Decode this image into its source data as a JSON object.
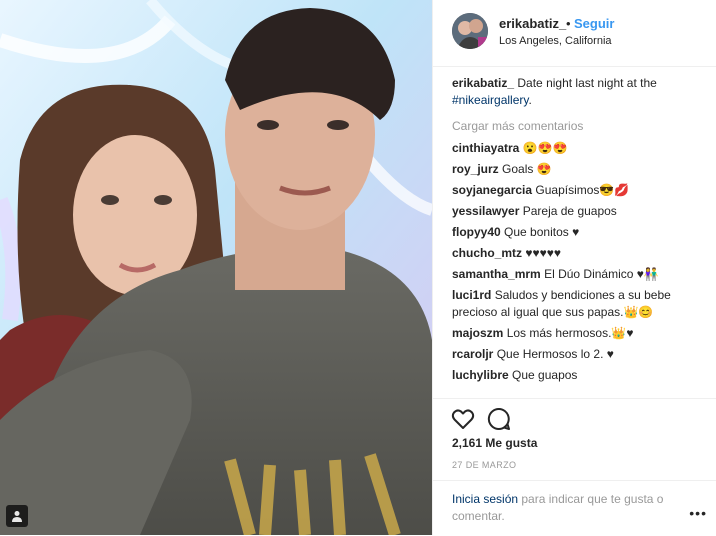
{
  "post": {
    "username": "erikabatiz_",
    "separator": "•",
    "follow_label": "Seguir",
    "location": "Los Angeles, California",
    "caption_user": "erikabatiz_",
    "caption_text": " Date night last night at the ",
    "caption_tag": "#nikeairgallery",
    "caption_end": ".",
    "load_more": "Cargar más comentarios",
    "likes": "2,161 Me gusta",
    "date": "27 DE MARZO",
    "login_link": "Inicia sesión",
    "login_text": " para indicar que te gusta o comentar.",
    "more_icon": "more-options-icon",
    "like_icon": "heart-icon",
    "comment_icon": "comment-bubble-icon"
  },
  "comments": [
    {
      "user": "cinthiayatra",
      "text": "😮😍😍"
    },
    {
      "user": "roy_jurz",
      "text": "Goals 😍"
    },
    {
      "user": "soyjanegarcia",
      "text": "Guapísimos😎💋"
    },
    {
      "user": "yessilawyer",
      "text": "Pareja de guapos"
    },
    {
      "user": "flopyy40",
      "text": "Que bonitos ♥"
    },
    {
      "user": "chucho_mtz",
      "text": "♥♥♥♥♥"
    },
    {
      "user": "samantha_mrm",
      "text": "El Dúo Dinámico ♥👫"
    },
    {
      "user": "luci1rd",
      "text": "Saludos y bendiciones a su bebe precioso al igual que sus papas.👑😊"
    },
    {
      "user": "majoszm",
      "text": "Los más hermosos.👑♥"
    },
    {
      "user": "rcaroljr",
      "text": "Que Hermosos lo 2. ♥"
    },
    {
      "user": "luchylibre",
      "text": "Que guapos"
    },
    {
      "user": "",
      "text": ""
    }
  ],
  "colors": {
    "link_blue": "#3897f0",
    "hashtag": "#003569",
    "muted": "#999999",
    "text": "#262626"
  }
}
